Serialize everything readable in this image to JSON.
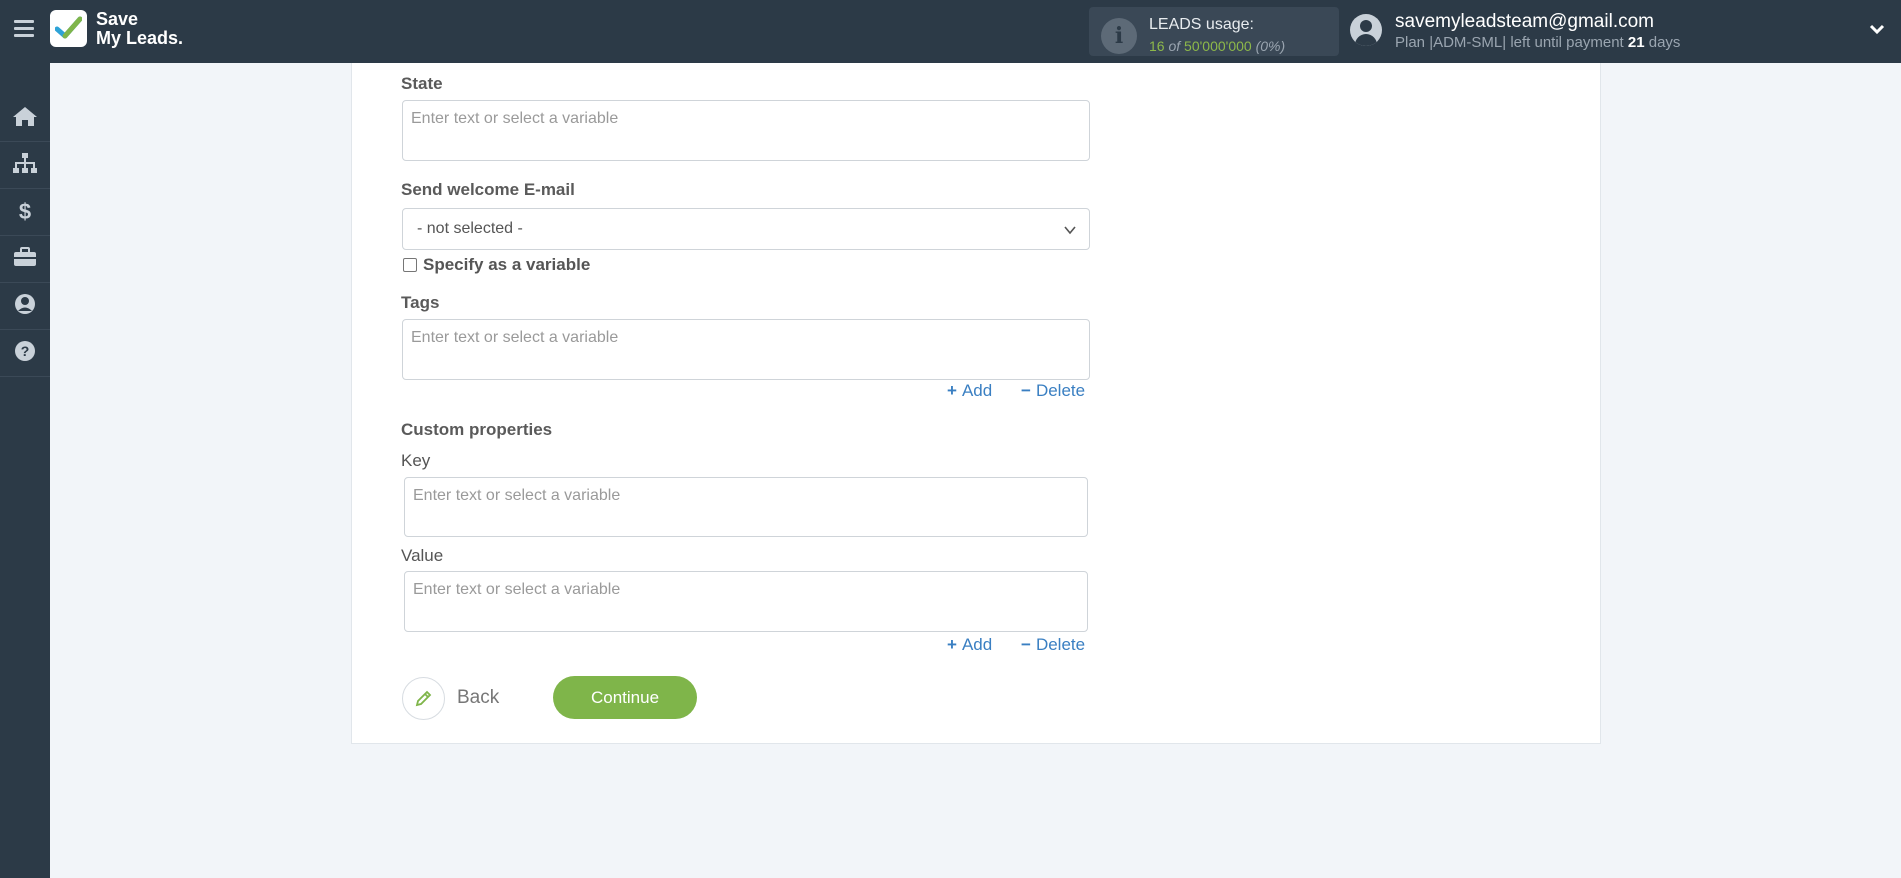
{
  "app": {
    "logo_line1": "Save",
    "logo_line2": "My Leads."
  },
  "usage": {
    "title": "LEADS usage:",
    "used": "16",
    "of": "of",
    "limit": "50'000'000",
    "percent": "(0%)"
  },
  "user": {
    "email": "savemyleadsteam@gmail.com",
    "plan_prefix": "Plan |ADM-SML| left until payment",
    "days": "21",
    "days_suffix": "days"
  },
  "sidebar": {
    "items": [
      {
        "icon": "home-icon"
      },
      {
        "icon": "sitemap-icon"
      },
      {
        "icon": "dollar-icon"
      },
      {
        "icon": "briefcase-icon"
      },
      {
        "icon": "user-circle-icon"
      },
      {
        "icon": "help-icon"
      }
    ]
  },
  "form": {
    "state_label": "State",
    "state_placeholder": "Enter text or select a variable",
    "welcome_label": "Send welcome E-mail",
    "welcome_value": "- not selected -",
    "specify_label": "Specify as a variable",
    "tags_label": "Tags",
    "tags_placeholder": "Enter text or select a variable",
    "add_label": "Add",
    "delete_label": "Delete",
    "custom_label": "Custom properties",
    "key_label": "Key",
    "key_placeholder": "Enter text or select a variable",
    "value_label": "Value",
    "value_placeholder": "Enter text or select a variable",
    "back_label": "Back",
    "continue_label": "Continue"
  },
  "colors": {
    "accent_green": "#7fb54a",
    "link_blue": "#3a7fc2",
    "topbar": "#2c3a47"
  }
}
